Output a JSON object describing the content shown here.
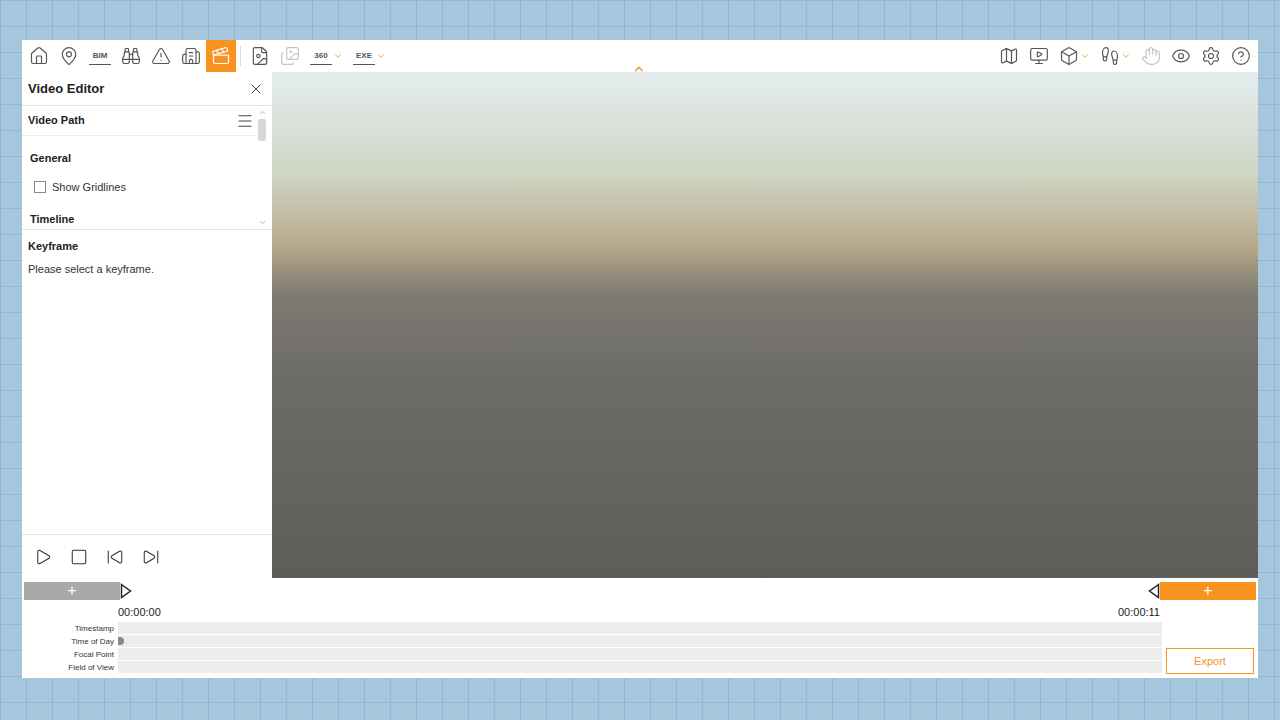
{
  "toolbar": {
    "left": [
      {
        "kind": "icon",
        "selected": false,
        "disabled": false,
        "has_menu": false
      },
      {
        "kind": "icon",
        "selected": false,
        "disabled": false,
        "has_menu": false
      },
      {
        "kind": "text",
        "label": "BIM",
        "selected": false,
        "disabled": false,
        "has_menu": false
      },
      {
        "kind": "icon",
        "selected": false,
        "disabled": false,
        "has_menu": false
      },
      {
        "kind": "icon",
        "selected": false,
        "disabled": false,
        "has_menu": false
      },
      {
        "kind": "icon",
        "selected": false,
        "disabled": false,
        "has_menu": false
      },
      {
        "kind": "icon",
        "selected": true,
        "disabled": false,
        "has_menu": false
      }
    ],
    "middle": [
      {
        "kind": "icon",
        "selected": false,
        "disabled": false,
        "has_menu": false
      },
      {
        "kind": "icon",
        "selected": false,
        "disabled": true,
        "has_menu": false
      },
      {
        "kind": "text",
        "label": "360",
        "selected": false,
        "disabled": false,
        "has_menu": true
      },
      {
        "kind": "text",
        "label": "EXE",
        "selected": false,
        "disabled": false,
        "has_menu": true
      }
    ],
    "right": [
      {
        "kind": "icon",
        "selected": false,
        "disabled": false,
        "has_menu": false
      },
      {
        "kind": "icon",
        "selected": false,
        "disabled": false,
        "has_menu": false
      },
      {
        "kind": "icon",
        "selected": false,
        "disabled": false,
        "has_menu": true
      },
      {
        "kind": "icon",
        "selected": false,
        "disabled": false,
        "has_menu": true
      },
      {
        "kind": "icon",
        "selected": false,
        "disabled": true,
        "has_menu": false
      },
      {
        "kind": "icon",
        "selected": false,
        "disabled": false,
        "has_menu": false
      },
      {
        "kind": "icon",
        "selected": false,
        "disabled": false,
        "has_menu": false
      },
      {
        "kind": "icon",
        "selected": false,
        "disabled": false,
        "has_menu": false
      }
    ]
  },
  "panel": {
    "title": "Video Editor",
    "section": "Video Path",
    "group": "General",
    "checkbox": {
      "label": "Show Gridlines",
      "checked": false
    },
    "next_group": "Timeline",
    "keyframe": {
      "title": "Keyframe",
      "message": "Please select a keyframe."
    }
  },
  "timeline": {
    "add_start": "+",
    "add_end": "+",
    "start_time": "00:00:00",
    "end_time": "00:00:11",
    "tracks": [
      {
        "label": "Timestamp",
        "has_keyframe": false
      },
      {
        "label": "Time of Day",
        "has_keyframe": true
      },
      {
        "label": "Focal Point",
        "has_keyframe": false
      },
      {
        "label": "Field of View",
        "has_keyframe": false
      }
    ],
    "export": "Export"
  }
}
